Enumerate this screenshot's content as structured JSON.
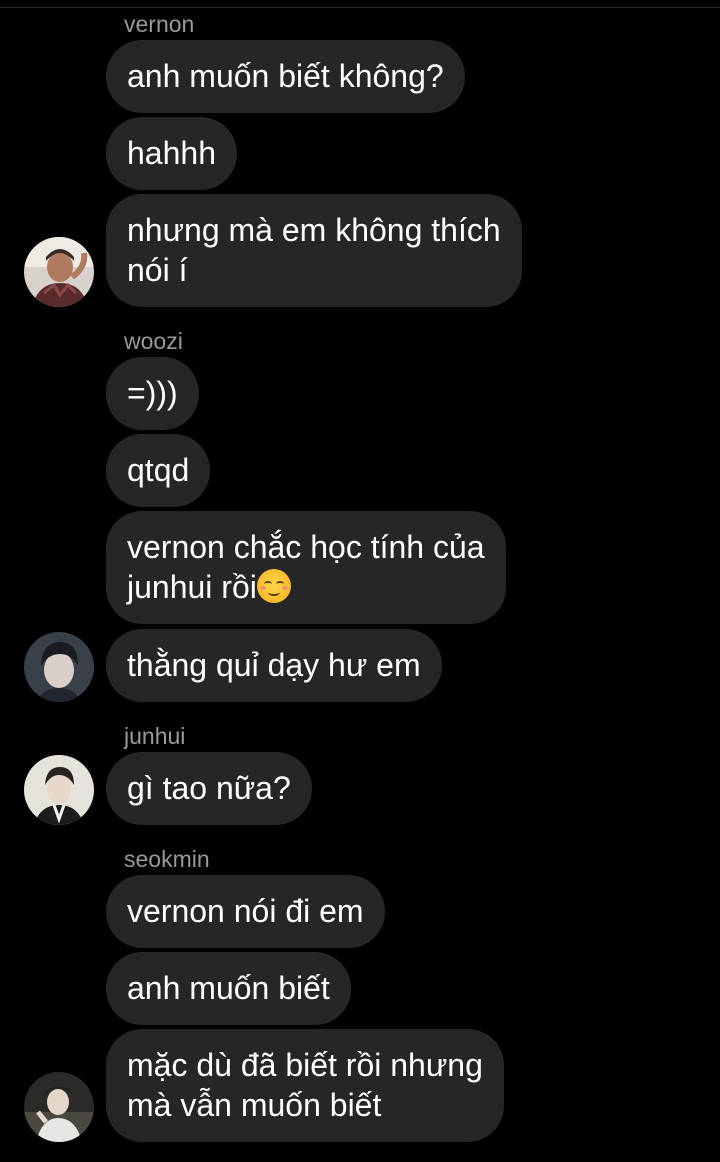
{
  "chat": {
    "groups": [
      {
        "sender": "vernon",
        "messages": [
          "anh muốn biết không?",
          "hahhh",
          "nhưng mà em không thích",
          "nói í"
        ]
      },
      {
        "sender": "woozi",
        "messages": [
          "=)))",
          "qtqd",
          "vernon chắc học tính của",
          "junhui rồi",
          "thằng quỉ dạy hư em"
        ]
      },
      {
        "sender": "junhui",
        "messages": [
          "gì tao nữa?"
        ]
      },
      {
        "sender": "seokmin",
        "messages": [
          "vernon nói đi em",
          "anh muốn biết",
          "mặc dù đã biết rồi nhưng",
          "mà vẫn muốn biết"
        ]
      }
    ],
    "emoji": "relieved-face-emoji"
  },
  "colors": {
    "background": "#000000",
    "bubble": "#262628",
    "sender_label": "#9a9a9e",
    "message_text": "#ffffff"
  }
}
